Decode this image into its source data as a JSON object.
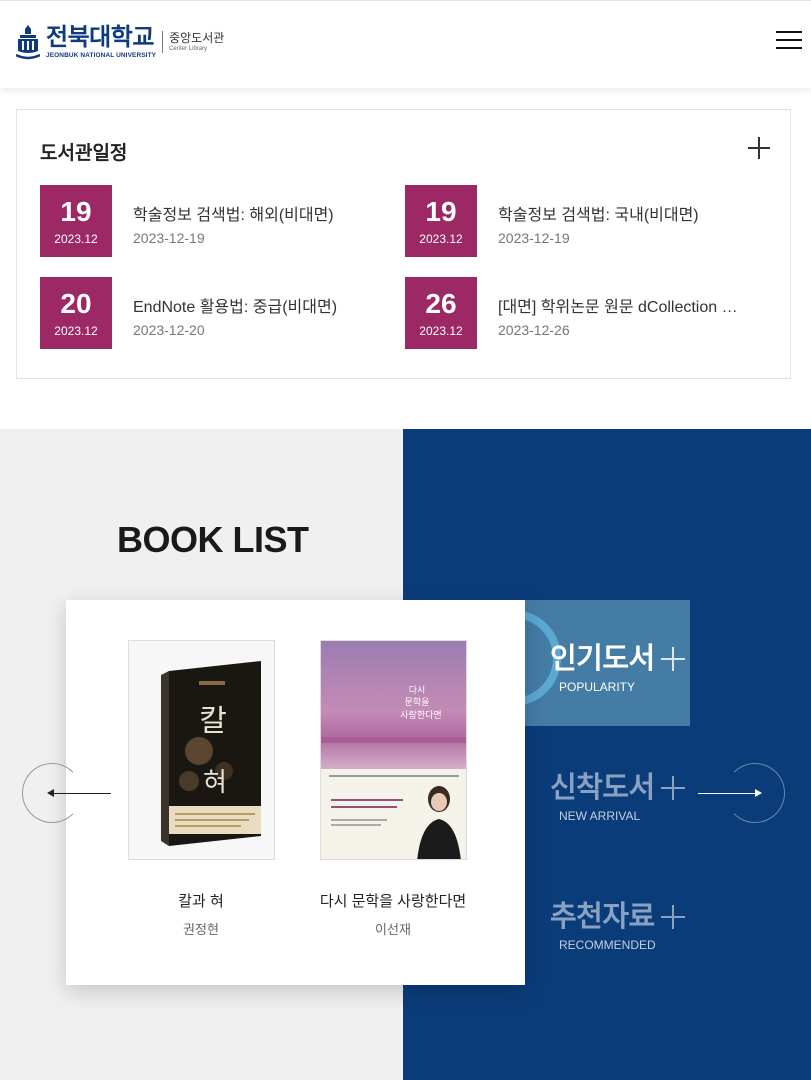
{
  "header": {
    "logo_title": "전북대학교",
    "logo_subtitle": "JEONBUK NATIONAL UNIVERSITY",
    "library_name": "중앙도서관",
    "library_name_en": "Center Library"
  },
  "schedule": {
    "title": "도서관일정",
    "events": [
      {
        "day": "19",
        "year_month": "2023.12",
        "title": "학술정보 검색법: 해외(비대면)",
        "date": "2023-12-19"
      },
      {
        "day": "19",
        "year_month": "2023.12",
        "title": "학술정보 검색법: 국내(비대면)",
        "date": "2023-12-19"
      },
      {
        "day": "20",
        "year_month": "2023.12",
        "title": "EndNote 활용법: 중급(비대면)",
        "date": "2023-12-20"
      },
      {
        "day": "26",
        "year_month": "2023.12",
        "title": "[대면] 학위논문 원문 dCollection 제…",
        "date": "2023-12-26"
      }
    ]
  },
  "book_list": {
    "heading": "BOOK LIST",
    "books": [
      {
        "title": "칼과 혀",
        "author": "권정현",
        "cover_text": "칼과혀"
      },
      {
        "title": "다시 문학을 사랑한다면",
        "author": "이선재",
        "cover_text": "다시 문학을 사랑한다면"
      }
    ],
    "tabs": [
      {
        "label": "인기도서",
        "sublabel": "POPULARITY",
        "active": true
      },
      {
        "label": "신착도서",
        "sublabel": "NEW ARRIVAL",
        "active": false
      },
      {
        "label": "추천자료",
        "sublabel": "RECOMMENDED",
        "active": false
      }
    ]
  },
  "colors": {
    "brand_navy": "#0b3c7a",
    "date_badge": "#9c2866",
    "active_tab": "#447ca6",
    "left_panel": "#f0f0f0"
  }
}
